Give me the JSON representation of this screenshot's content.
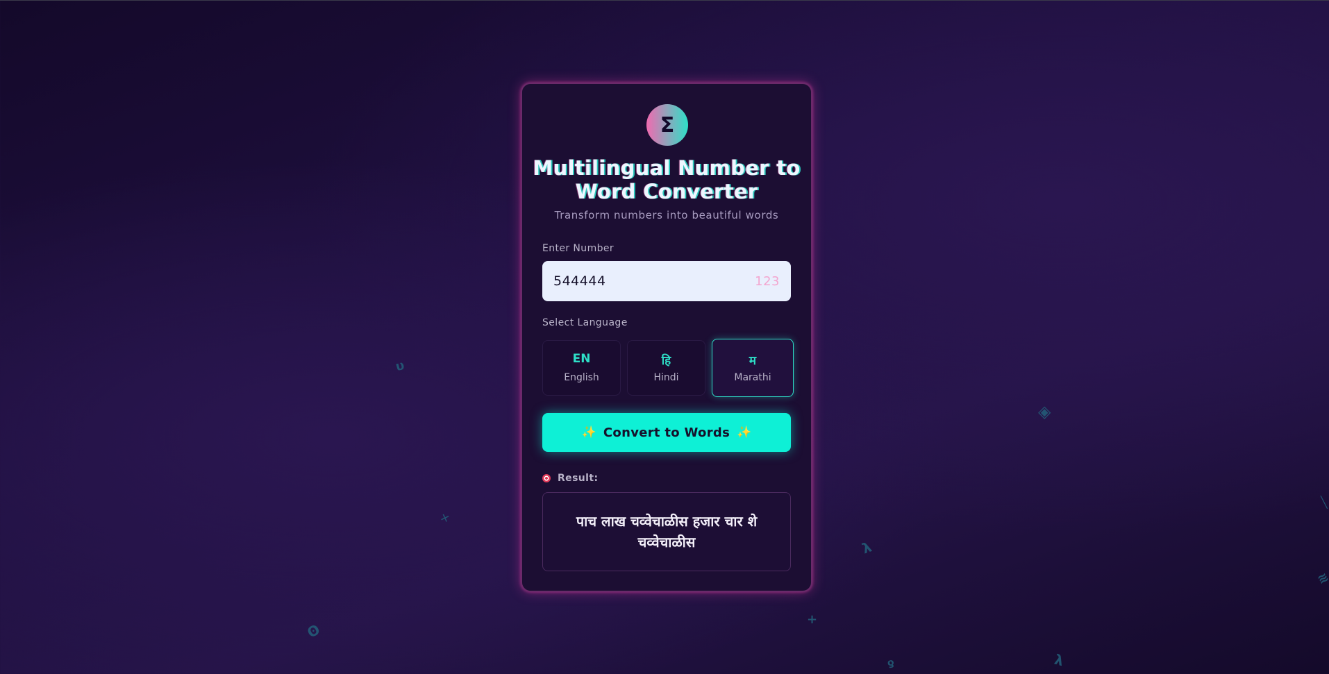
{
  "floating_glyphs": [
    {
      "char": "υ"
    },
    {
      "char": "✕"
    },
    {
      "char": "ʘ"
    },
    {
      "char": "◈"
    },
    {
      "char": "λ"
    },
    {
      "char": "+"
    },
    {
      "char": "ƍ"
    },
    {
      "char": "λ"
    },
    {
      "char": "≋"
    },
    {
      "char": "╲"
    }
  ],
  "app": {
    "logo_glyph": "Σ",
    "title": "Multilingual Number to Word Converter",
    "subtitle": "Transform numbers into beautiful words"
  },
  "number_input": {
    "label": "Enter Number",
    "value": "544444",
    "hint": "123"
  },
  "language": {
    "label": "Select Language",
    "options": [
      {
        "code": "EN",
        "name": "English",
        "active": false
      },
      {
        "code": "हि",
        "name": "Hindi",
        "active": false
      },
      {
        "code": "म",
        "name": "Marathi",
        "active": true
      }
    ]
  },
  "convert_button": {
    "label": "Convert to Words",
    "sparkle": "✨"
  },
  "result": {
    "label": "Result:",
    "icon": "target-icon",
    "text": "पाच लाख चव्वेचाळीस हजार चार शे चव्वेचाळीस"
  },
  "colors": {
    "accent_cyan": "#0ef0d6",
    "accent_pink": "#f06ab0",
    "card_bg": "#1c0e33",
    "page_bg": "#1f1040"
  }
}
